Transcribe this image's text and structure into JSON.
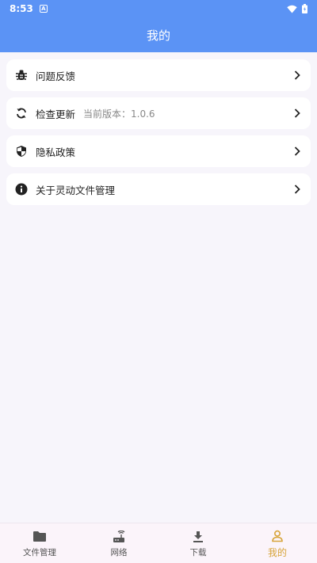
{
  "status_bar": {
    "time": "8:53",
    "notification_icon": "A"
  },
  "header": {
    "title": "我的"
  },
  "menu": {
    "items": [
      {
        "label": "问题反馈",
        "icon": "bug-icon"
      },
      {
        "label": "检查更新",
        "sub": "当前版本：1.0.6",
        "icon": "refresh-icon"
      },
      {
        "label": "隐私政策",
        "icon": "shield-icon"
      },
      {
        "label": "关于灵动文件管理",
        "icon": "info-icon"
      }
    ]
  },
  "bottom_nav": {
    "items": [
      {
        "label": "文件管理",
        "icon": "folder-icon"
      },
      {
        "label": "网络",
        "icon": "router-icon"
      },
      {
        "label": "下载",
        "icon": "download-icon"
      },
      {
        "label": "我的",
        "icon": "person-icon",
        "active": true
      }
    ]
  },
  "colors": {
    "header": "#5b93f5",
    "active_nav": "#d7a43a",
    "background": "#f7f5fb"
  }
}
